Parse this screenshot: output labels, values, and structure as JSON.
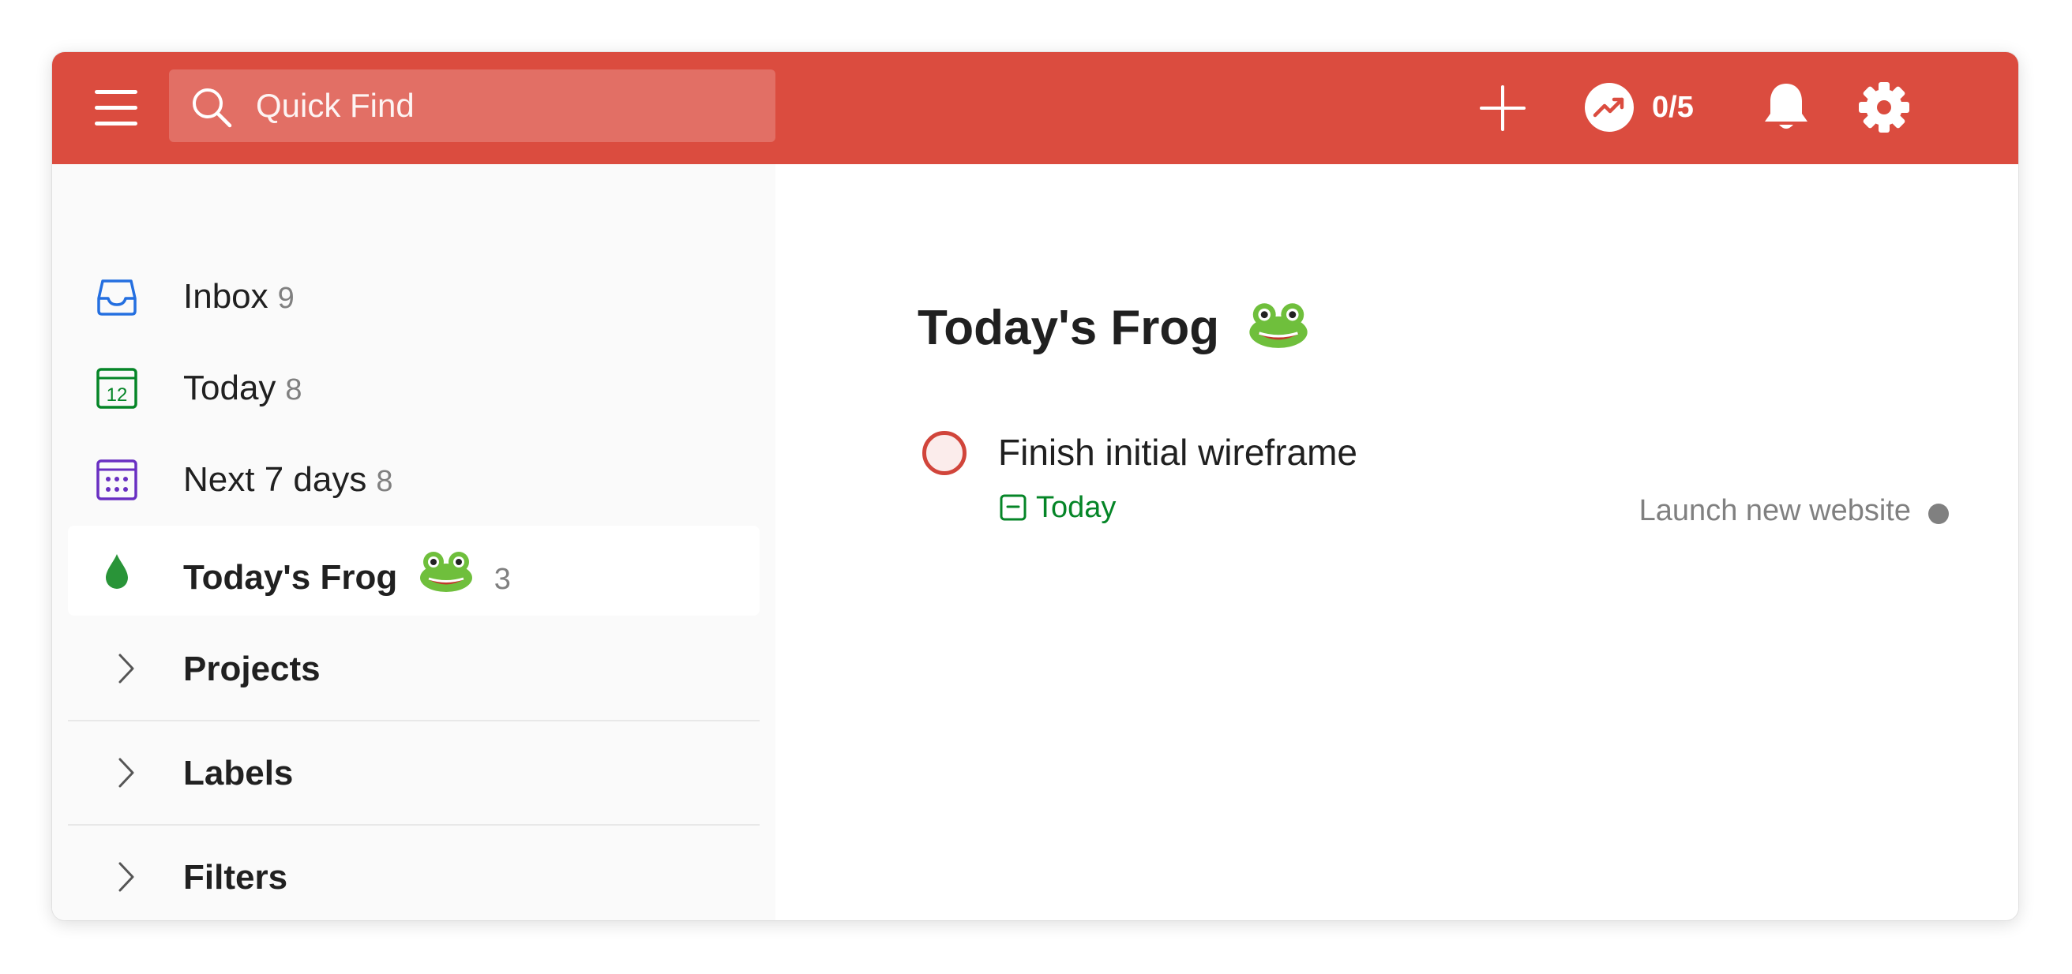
{
  "topbar": {
    "background": "#db4c3f",
    "search_placeholder": "Quick Find",
    "karma": "0/5",
    "icons": [
      "menu-icon",
      "search-icon",
      "plus-icon",
      "karma-icon",
      "bell-icon",
      "gear-icon"
    ]
  },
  "sidebar": {
    "items": [
      {
        "label": "Inbox",
        "count": "9",
        "icon": "inbox-icon",
        "color": "#246fe0"
      },
      {
        "label": "Today",
        "count": "8",
        "icon": "calendar-today-icon",
        "icon_text": "12",
        "color": "#058527"
      },
      {
        "label": "Next 7 days",
        "count": "8",
        "icon": "calendar-week-icon",
        "color": "#692fc2"
      },
      {
        "label": "Today's Frog",
        "count": "3",
        "icon": "drop-icon",
        "color": "#299438",
        "active": true
      }
    ],
    "sections": [
      {
        "label": "Projects"
      },
      {
        "label": "Labels"
      },
      {
        "label": "Filters"
      }
    ]
  },
  "main": {
    "title": "Today's Frog",
    "tasks": [
      {
        "title": "Finish initial wireframe",
        "due": "Today",
        "due_color": "#058527",
        "project": "Launch new website",
        "priority_color": "#d1453b"
      }
    ]
  }
}
